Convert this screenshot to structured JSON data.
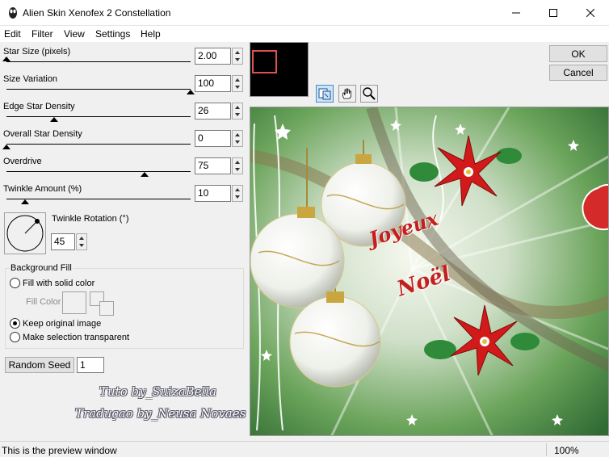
{
  "window": {
    "title": "Alien Skin Xenofex 2 Constellation"
  },
  "menu": [
    "Edit",
    "Filter",
    "View",
    "Settings",
    "Help"
  ],
  "sliders": [
    {
      "label": "Star Size (pixels)",
      "value": "2.00",
      "level": 0.0
    },
    {
      "label": "Size Variation",
      "value": "100",
      "level": 1.0
    },
    {
      "label": "Edge Star Density",
      "value": "26",
      "level": 0.26
    },
    {
      "label": "Overall Star Density",
      "value": "0",
      "level": 0.0
    },
    {
      "label": "Overdrive",
      "value": "75",
      "level": 0.75
    },
    {
      "label": "Twinkle Amount (%)",
      "value": "10",
      "level": 0.1
    }
  ],
  "rotation": {
    "label": "Twinkle Rotation (°)",
    "value": "45"
  },
  "background_fill": {
    "title": "Background Fill",
    "options": [
      {
        "label": "Fill with solid color",
        "checked": false
      },
      {
        "label": "Keep original image",
        "checked": true
      },
      {
        "label": "Make selection transparent",
        "checked": false
      }
    ],
    "fill_color_label": "Fill Color"
  },
  "random_seed": {
    "label": "Random Seed",
    "value": "1"
  },
  "buttons": {
    "ok": "OK",
    "cancel": "Cancel"
  },
  "preview": {
    "text1": "Joyeux",
    "text2": "Noël",
    "credit1": "Tuto by_SuizaBella",
    "credit2": "Traduçao by_Neusa Novaes"
  },
  "status": {
    "message": "This is the preview window",
    "zoom": "100%"
  },
  "colors": {
    "accent": "#cc2222",
    "preview_green": "#5a9a4a"
  }
}
